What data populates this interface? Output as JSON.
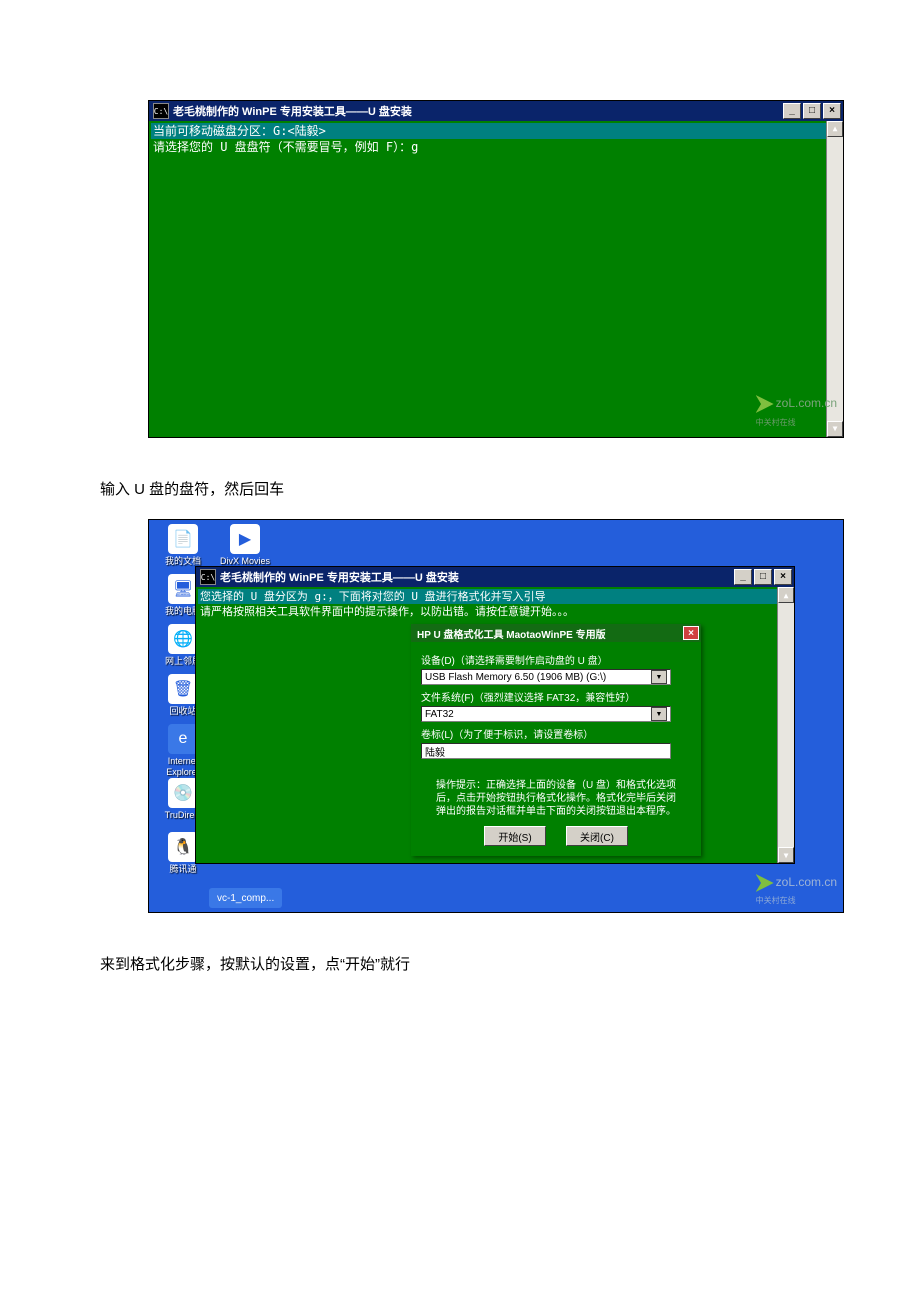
{
  "screenshot1": {
    "titlebar": {
      "icon_text": "C:\\",
      "title": "老毛桃制作的 WinPE 专用安装工具——U 盘安装"
    },
    "win_buttons": {
      "min": "_",
      "max": "□",
      "close": "×"
    },
    "lines": {
      "l1": "当前可移动磁盘分区：G:<陆毅>",
      "l2": "请选择您的 U 盘盘符（不需要冒号，例如 F）：g"
    },
    "scrollbar": {
      "up": "▲",
      "down": "▼"
    },
    "watermark": {
      "text": "zoL.com.cn",
      "sub": "中关村在线"
    }
  },
  "caption1": "输入 U 盘的盘符，然后回车",
  "desktop": {
    "icons": {
      "mydocs": "我的文档",
      "divx": "DivX Movies",
      "mycomputer": "我的电脑",
      "network": "网上邻居",
      "recycle": "回收站",
      "ie": "Internet Explorer",
      "dvd": "TruDirect",
      "qq": "腾讯通"
    },
    "taskbar": {
      "item1": "vc-1_comp..."
    },
    "watermark": {
      "text": "zoL.com.cn",
      "sub": "中关村在线"
    }
  },
  "screenshot2": {
    "titlebar": {
      "icon_text": "C:\\",
      "title": "老毛桃制作的 WinPE 专用安装工具——U 盘安装"
    },
    "lines": {
      "l1": "您选择的 U 盘分区为 g:，下面将对您的 U 盘进行格式化并写入引导",
      "l2": "请严格按照相关工具软件界面中的提示操作，以防出错。请按任意键开始。。。"
    }
  },
  "dialog": {
    "title": "HP U 盘格式化工具 MaotaoWinPE 专用版",
    "close": "×",
    "device_label": "设备(D)（请选择需要制作启动盘的 U 盘）",
    "device_value": "USB Flash Memory 6.50 (1906 MB) (G:\\)",
    "fs_label": "文件系统(F)（强烈建议选择 FAT32，兼容性好）",
    "fs_value": "FAT32",
    "vol_label": "卷标(L)（为了便于标识，请设置卷标）",
    "vol_value": "陆毅",
    "note_l1": "操作提示：正确选择上面的设备（U 盘）和格式化选项",
    "note_l2": "后，点击开始按钮执行格式化操作。格式化完毕后关闭",
    "note_l3": "弹出的报告对话框并单击下面的关闭按钮退出本程序。",
    "btn_start": "开始(S)",
    "btn_close": "关闭(C)"
  },
  "caption2": "来到格式化步骤，按默认的设置，点“开始”就行"
}
